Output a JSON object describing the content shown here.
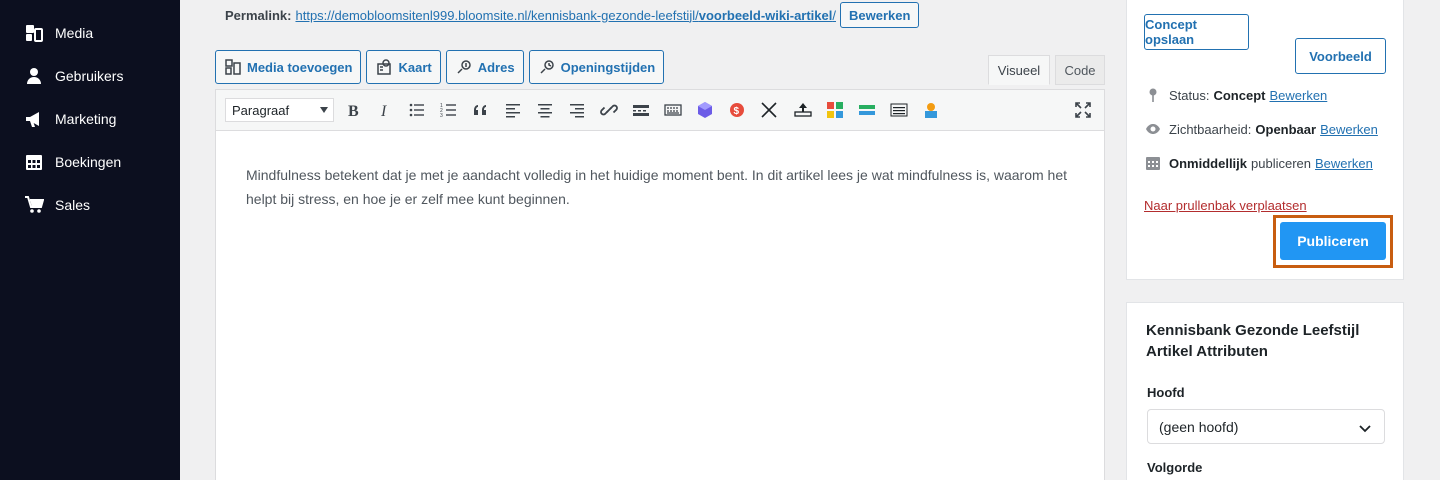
{
  "sidebar": {
    "items": [
      {
        "label": "Media",
        "icon": "media-icon"
      },
      {
        "label": "Gebruikers",
        "icon": "user-icon"
      },
      {
        "label": "Marketing",
        "icon": "megaphone-icon"
      },
      {
        "label": "Boekingen",
        "icon": "calendar-icon"
      },
      {
        "label": "Sales",
        "icon": "cart-icon"
      }
    ]
  },
  "permalink": {
    "label": "Permalink:",
    "url_base": "https://demobloomsitenl999.bloomsite.nl/kennisbank-gezonde-leefstijl/",
    "url_slug": "voorbeeld-wiki-artikel",
    "url_trailing": "/",
    "edit_label": "Bewerken"
  },
  "media_buttons": [
    {
      "label": "Media toevoegen",
      "icon": "media-add-icon"
    },
    {
      "label": "Kaart",
      "icon": "map-icon"
    },
    {
      "label": "Adres",
      "icon": "address-icon"
    },
    {
      "label": "Openingstijden",
      "icon": "opening-hours-icon"
    }
  ],
  "editor_tabs": {
    "visual": "Visueel",
    "code": "Code",
    "active": "visual"
  },
  "toolbar": {
    "format_value": "Paragraaf",
    "buttons": [
      "bold-icon",
      "italic-icon",
      "bullet-list-icon",
      "numbered-list-icon",
      "blockquote-icon",
      "align-left-icon",
      "align-center-icon",
      "align-right-icon",
      "link-icon",
      "read-more-icon",
      "toolbar-toggle-icon",
      "shortcode-icon",
      "dollar-icon",
      "x-icon",
      "upload-icon",
      "grid-icon",
      "toggle-bar-icon",
      "lines-icon",
      "person-icon",
      "fullscreen-icon"
    ]
  },
  "editor": {
    "content": "Mindfulness betekent dat je met je aandacht volledig in het huidige moment bent. In dit artikel lees je wat mindfulness is, waarom het helpt bij stress, en hoe je er zelf mee kunt beginnen."
  },
  "publish": {
    "save_draft_label": "Concept opslaan",
    "preview_label": "Voorbeeld",
    "status_label": "Status:",
    "status_value": "Concept",
    "visibility_label": "Zichtbaarheid:",
    "visibility_value": "Openbaar",
    "schedule_value": "Onmiddellijk",
    "schedule_label": "publiceren",
    "edit_label": "Bewerken",
    "trash_label": "Naar prullenbak verplaatsen",
    "publish_label": "Publiceren"
  },
  "attributes": {
    "title": "Kennisbank Gezonde Leefstijl Artikel Attributen",
    "parent_label": "Hoofd",
    "parent_value": "(geen hoofd)",
    "order_label": "Volgorde"
  },
  "colors": {
    "sidebar_bg": "#0c0f1f",
    "link": "#2271b1",
    "primary_button": "#2196f3",
    "highlight": "#c85d10",
    "danger": "#b32d2e"
  }
}
